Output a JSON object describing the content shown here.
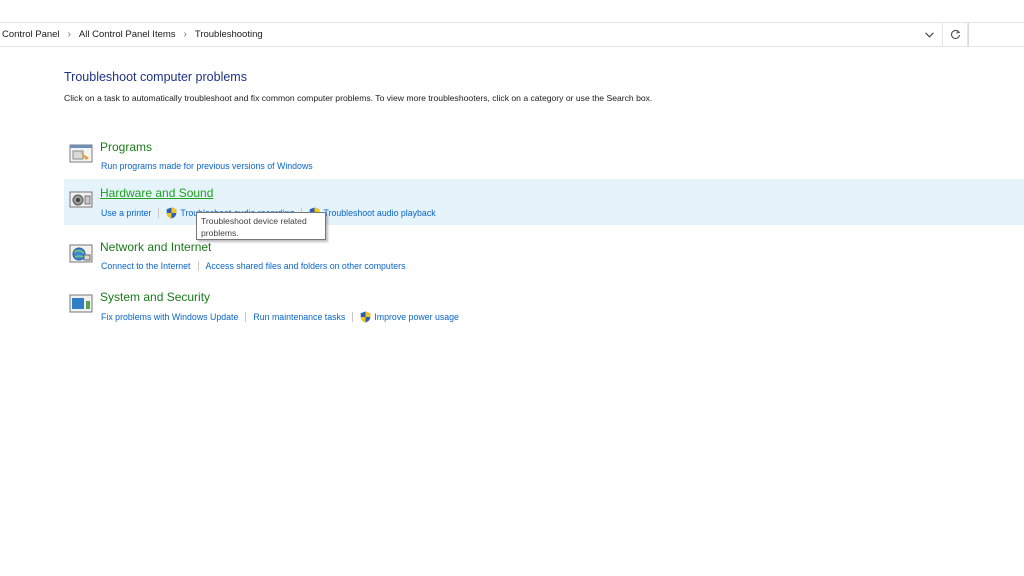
{
  "breadcrumb": {
    "items": [
      "Control Panel",
      "All Control Panel Items",
      "Troubleshooting"
    ]
  },
  "icons": {
    "separator": "chevron-right-icon",
    "dropdown": "chevron-down-icon",
    "refresh": "refresh-icon",
    "shield": "uac-shield-icon"
  },
  "main": {
    "title": "Troubleshoot computer problems",
    "description": "Click on a task to automatically troubleshoot and fix common computer problems. To view more troubleshooters, click on a category or use the Search box."
  },
  "categories": [
    {
      "title": "Programs",
      "icon": "programs-icon",
      "links": [
        {
          "label": "Run programs made for previous versions of Windows",
          "shield": false
        }
      ]
    },
    {
      "title": "Hardware and Sound",
      "icon": "hardware-sound-icon",
      "links": [
        {
          "label": "Use a printer",
          "shield": false
        },
        {
          "label": "Troubleshoot audio recording",
          "shield": true
        },
        {
          "label": "Troubleshoot audio playback",
          "shield": true
        }
      ]
    },
    {
      "title": "Network and Internet",
      "icon": "network-icon",
      "links": [
        {
          "label": "Connect to the Internet",
          "shield": false
        },
        {
          "label": "Access shared files and folders on other computers",
          "shield": false
        }
      ]
    },
    {
      "title": "System and Security",
      "icon": "system-security-icon",
      "links": [
        {
          "label": "Fix problems with Windows Update",
          "shield": false
        },
        {
          "label": "Run maintenance tasks",
          "shield": false
        },
        {
          "label": "Improve power usage",
          "shield": true
        }
      ]
    }
  ],
  "tooltip": {
    "text": "Troubleshoot device related problems."
  },
  "colors": {
    "title_blue": "#1e3287",
    "category_green": "#1a7a1a",
    "link_blue": "#0a64c8",
    "hover_bg": "#e5f3fb"
  }
}
